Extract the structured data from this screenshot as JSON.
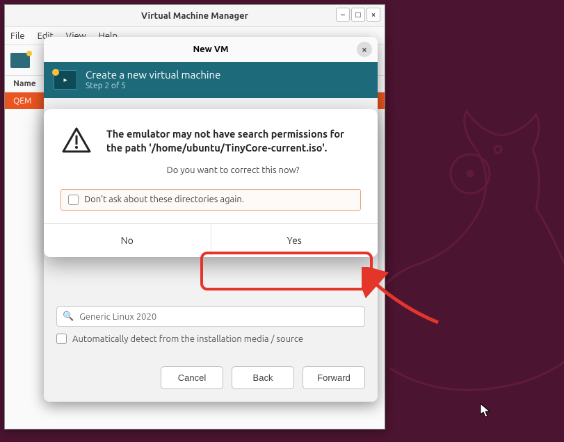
{
  "vmm": {
    "title": "Virtual Machine Manager",
    "menu": {
      "file": "File",
      "edit": "Edit",
      "view": "View",
      "help": "Help"
    },
    "column_name": "Name",
    "qemu_row": "QEM"
  },
  "newvm": {
    "dialog_title": "New VM",
    "header_title": "Create a new virtual machine",
    "header_step": "Step 2 of 5",
    "os_value": "Generic Linux 2020",
    "autodetect_label": "Automatically detect from the installation media / source",
    "buttons": {
      "cancel": "Cancel",
      "back": "Back",
      "forward": "Forward"
    }
  },
  "alert": {
    "heading": "The emulator may not have search permissions for the path '/home/ubuntu/TinyCore-current.iso'.",
    "question": "Do you want to correct this now?",
    "checkbox_label": "Don't ask about these directories again.",
    "no_label": "No",
    "yes_label": "Yes"
  }
}
